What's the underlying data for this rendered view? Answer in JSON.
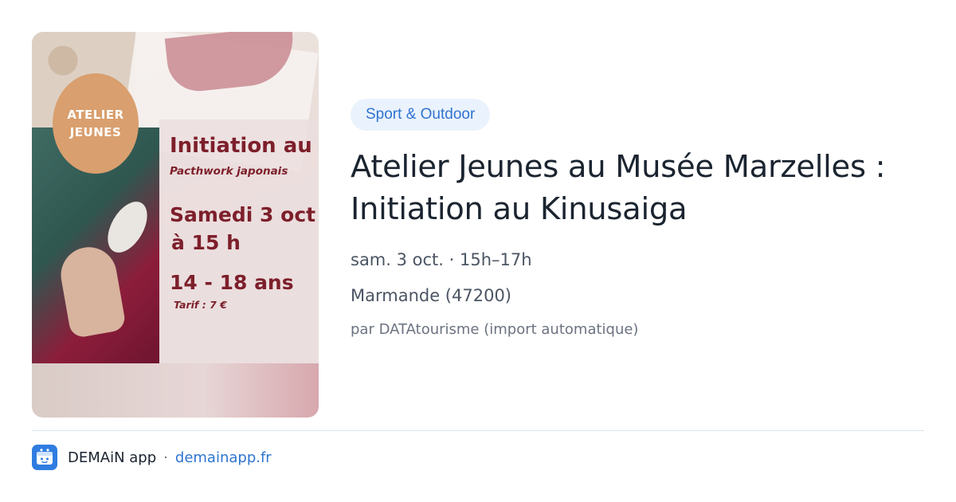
{
  "poster": {
    "badge_line1": "ATELIER",
    "badge_line2": "JEUNES",
    "title": "Initiation au",
    "subtitle": "Pacthwork japonais",
    "date": "Samedi 3 oct",
    "time": "à 15 h",
    "age": "14 - 18 ans",
    "tarif": "Tarif : 7 €"
  },
  "event": {
    "category": "Sport & Outdoor",
    "title": "Atelier Jeunes au Musée Marzelles : Initiation au Kinusaiga",
    "date_time": "sam. 3 oct. · 15h–17h",
    "location": "Marmande (47200)",
    "source": "par DATAtourisme (import automatique)"
  },
  "footer": {
    "icon": "demain-app-icon",
    "app_name": "DEMAiN app",
    "separator": "·",
    "domain": "demainapp.fr"
  },
  "colors": {
    "accent": "#2f74d0",
    "chip_background": "#eaf2fd",
    "poster_text": "#7d1f2b",
    "badge": "#d99f6e",
    "app_icon": "#2f7de1"
  }
}
